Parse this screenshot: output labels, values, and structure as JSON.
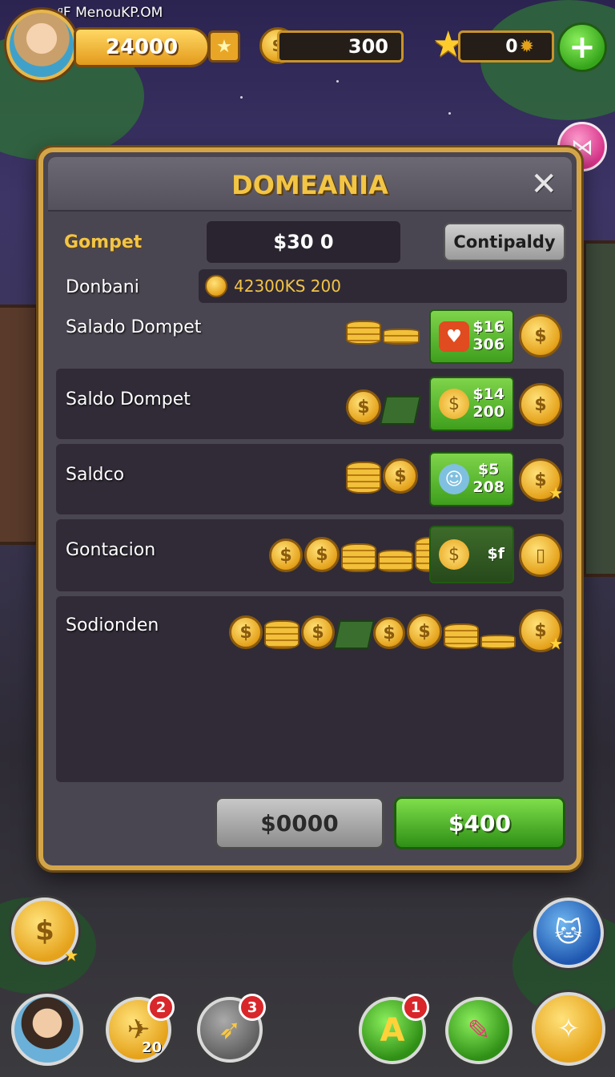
{
  "header": {
    "site_label": "ᵍF MenouKP.OM",
    "gold_value": "24000",
    "coin_value": "300",
    "star_value": "0"
  },
  "panel": {
    "title": "DOMEANIA",
    "wallet_label": "Gompet",
    "wallet_value": "$30 0",
    "wallet_button": "Contipaldy",
    "balance_label": "Donbani",
    "balance_value": "42300KS 200"
  },
  "rows": [
    {
      "label": "Salado Dompet",
      "price_top": "$16",
      "price_bottom": "306"
    },
    {
      "label": "Saldo Dompet",
      "price_top": "$14",
      "price_bottom": "200"
    },
    {
      "label": "Saldco",
      "price_top": "$5",
      "price_bottom": "208"
    },
    {
      "label": "Gontacion",
      "price_top": "$f",
      "price_bottom": ""
    },
    {
      "label": "Sodionden"
    }
  ],
  "footer": {
    "grey_button": "$0000",
    "green_button": "$400"
  },
  "nav": {
    "badge_map": "2",
    "badge_map_sub": "20",
    "badge_rocket": "3",
    "badge_a": "1"
  },
  "colors": {
    "accent_gold": "#f3c545",
    "accent_green": "#3f9f1d",
    "panel_border": "#d4a548"
  }
}
